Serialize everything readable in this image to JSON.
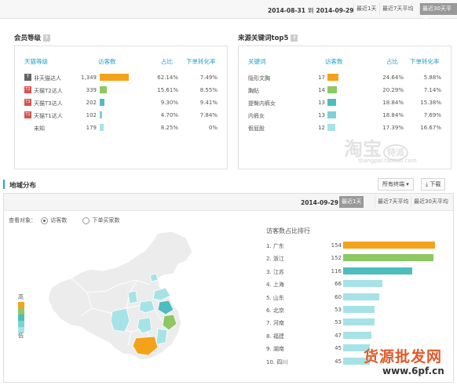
{
  "top": {
    "date_start": "2014-08-31",
    "date_sep": "到",
    "date_end": "2014-09-29",
    "ranges": [
      "最近1天",
      "最近7天平均",
      "最近30天平均"
    ],
    "active_range": 2
  },
  "member": {
    "title": "会员等级",
    "help": "?",
    "headers": [
      "天猫等级",
      "访客数",
      "占比",
      "下单转化率"
    ],
    "rows": [
      {
        "badge": "T",
        "badge_color": "#666666",
        "label": "非天猫达人",
        "visitors": "1,349",
        "share": "62.14%",
        "conv": "7.49%",
        "bar": 0.6214,
        "bar_color": "#f5a21b"
      },
      {
        "badge": "T2",
        "badge_color": "#d9534f",
        "label": "天猫T2达人",
        "visitors": "339",
        "share": "15.61%",
        "conv": "8.55%",
        "bar": 0.1561,
        "bar_color": "#8dc863"
      },
      {
        "badge": "T3",
        "badge_color": "#d9534f",
        "label": "天猫T3达人",
        "visitors": "202",
        "share": "9.30%",
        "conv": "9.41%",
        "bar": 0.093,
        "bar_color": "#4dbdbd"
      },
      {
        "badge": "T1",
        "badge_color": "#d9534f",
        "label": "天猫T1达人",
        "visitors": "102",
        "share": "4.70%",
        "conv": "7.84%",
        "bar": 0.047,
        "bar_color": "#7fd0d6"
      },
      {
        "badge": "",
        "badge_color": "",
        "label": "未知",
        "visitors": "179",
        "share": "8.25%",
        "conv": "0%",
        "bar": 0.0825,
        "bar_color": "#a6e3e6"
      }
    ]
  },
  "keywords": {
    "title": "来源关键词top5",
    "help": "?",
    "headers": [
      "关键词",
      "访客数",
      "占比",
      "下单转化率"
    ],
    "rows": [
      {
        "label": "隐形文胸",
        "visitors": "17",
        "share": "24.64%",
        "conv": "5.88%",
        "bar": 0.2464,
        "bar_color": "#f5a21b"
      },
      {
        "label": "胸贴",
        "visitors": "14",
        "share": "20.29%",
        "conv": "7.14%",
        "bar": 0.2029,
        "bar_color": "#8dc863"
      },
      {
        "label": "提臀内裤女",
        "visitors": "13",
        "share": "18.84%",
        "conv": "15.38%",
        "bar": 0.1884,
        "bar_color": "#4dbdbd"
      },
      {
        "label": "内裤女",
        "visitors": "13",
        "share": "18.84%",
        "conv": "7.69%",
        "bar": 0.1884,
        "bar_color": "#7fd0d6"
      },
      {
        "label": "假屁股",
        "visitors": "12",
        "share": "17.39%",
        "conv": "16.67%",
        "bar": 0.1739,
        "bar_color": "#a6e3e6"
      }
    ]
  },
  "watermark": {
    "brand": "淘宝",
    "tag": "特派",
    "url": "tbangpai.taobao.com"
  },
  "region": {
    "title": "地域分布",
    "terminal": "所有终端",
    "download": "下载",
    "date": "2014-09-29",
    "ranges": [
      "最近1天",
      "最近7天平均",
      "最近30天平均"
    ],
    "active_range": 0,
    "view_label": "查看对象：",
    "options": [
      "访客数",
      "下单买家数"
    ],
    "selected_option": 0,
    "legend_high": "高",
    "legend_low": "低",
    "legend_colors": [
      "#f5a21b",
      "#8dc863",
      "#4dbdbd",
      "#7fd0d6",
      "#a6e3e6"
    ],
    "rank_title": "访客数占比排行",
    "rank": [
      {
        "label": "1. 广东",
        "value": "154",
        "v": 154,
        "color": "#f5a21b"
      },
      {
        "label": "2. 浙江",
        "value": "152",
        "v": 152,
        "color": "#8dc863"
      },
      {
        "label": "3. 江苏",
        "value": "116",
        "v": 116,
        "color": "#4dbdbd"
      },
      {
        "label": "4. 上海",
        "value": "66",
        "v": 66,
        "color": "#a6e3e6"
      },
      {
        "label": "5. 山东",
        "value": "60",
        "v": 60,
        "color": "#a6e3e6"
      },
      {
        "label": "6. 北京",
        "value": "53",
        "v": 53,
        "color": "#a6e3e6"
      },
      {
        "label": "7. 河南",
        "value": "53",
        "v": 53,
        "color": "#a6e3e6"
      },
      {
        "label": "8. 福建",
        "value": "47",
        "v": 47,
        "color": "#a6e3e6"
      },
      {
        "label": "9. 湖南",
        "value": "45",
        "v": 45,
        "color": "#a6e3e6"
      },
      {
        "label": "10. 四川",
        "value": "45",
        "v": 45,
        "color": "#a6e3e6"
      }
    ]
  },
  "site_watermark": {
    "cn": "货源批发网",
    "url": "www.6pf.cn"
  }
}
